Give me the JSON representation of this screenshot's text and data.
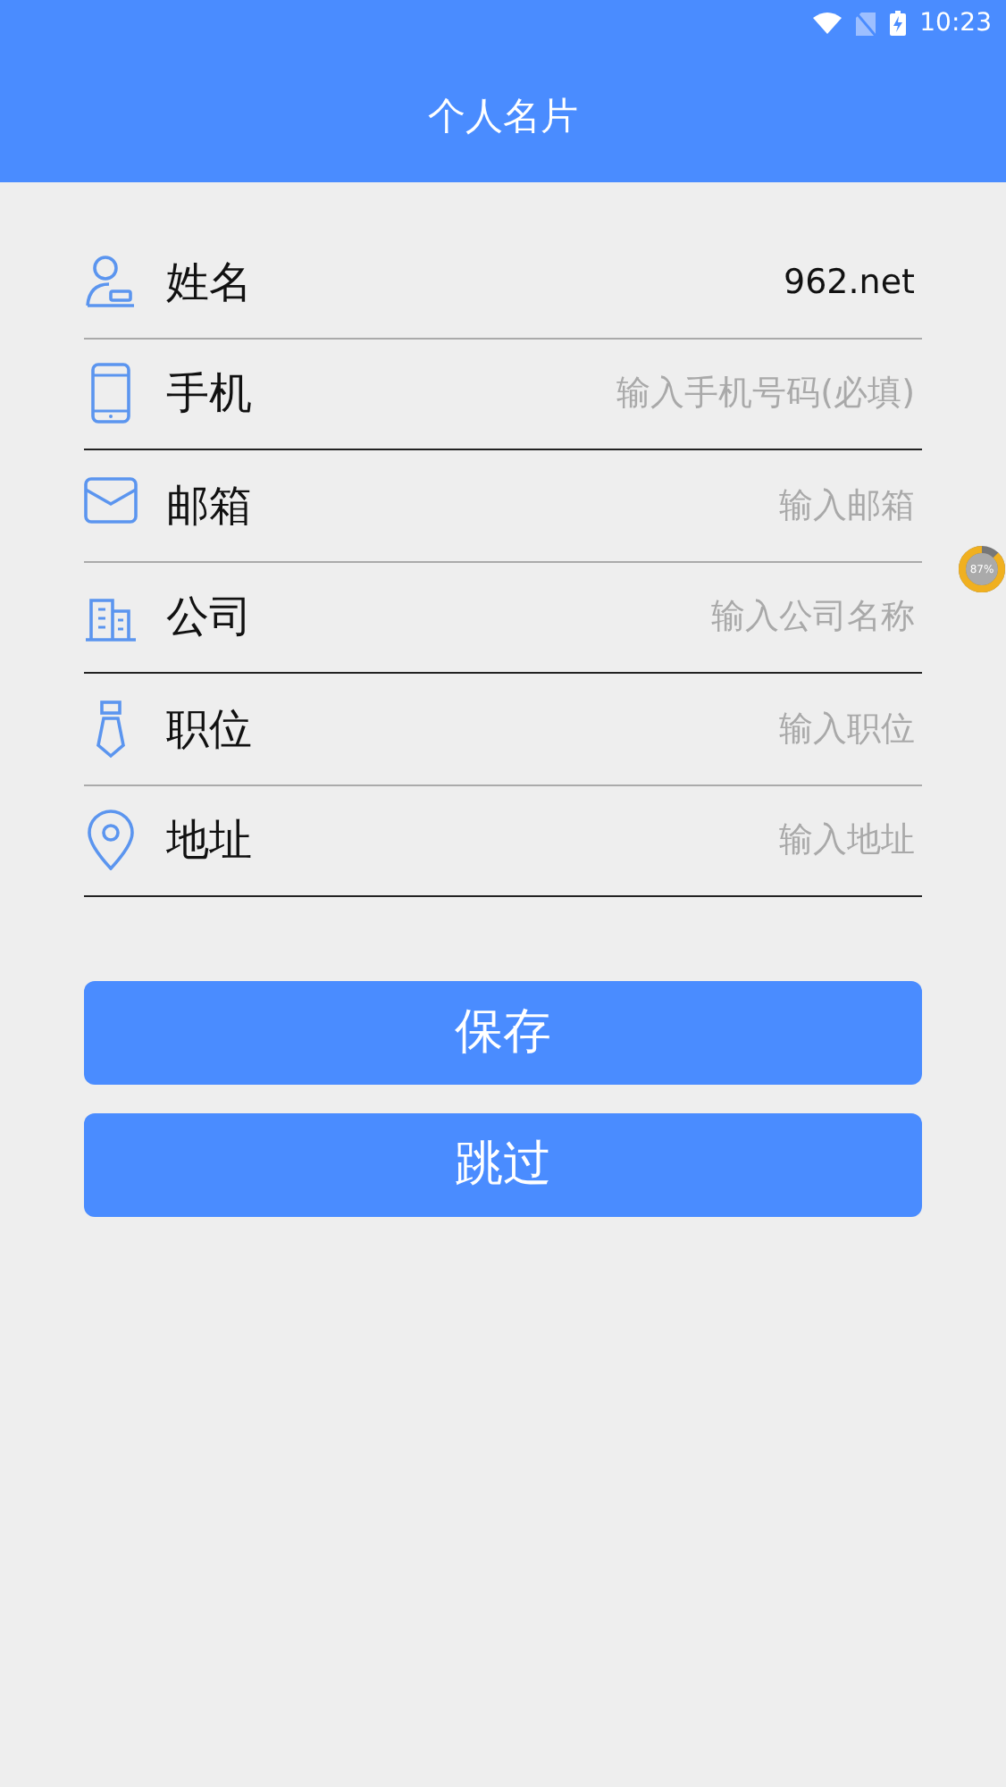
{
  "status_bar": {
    "time": "10:23"
  },
  "header": {
    "title": "个人名片"
  },
  "fields": [
    {
      "label": "姓名",
      "value": "962.net"
    },
    {
      "label": "手机",
      "placeholder": "输入手机号码(必填)"
    },
    {
      "label": "邮箱",
      "placeholder": "输入邮箱"
    },
    {
      "label": "公司",
      "placeholder": "输入公司名称"
    },
    {
      "label": "职位",
      "placeholder": "输入职位"
    },
    {
      "label": "地址",
      "placeholder": "输入地址"
    }
  ],
  "buttons": [
    "保存",
    "跳过"
  ],
  "floating_meter": {
    "level": 0.87,
    "reading": "87%"
  }
}
